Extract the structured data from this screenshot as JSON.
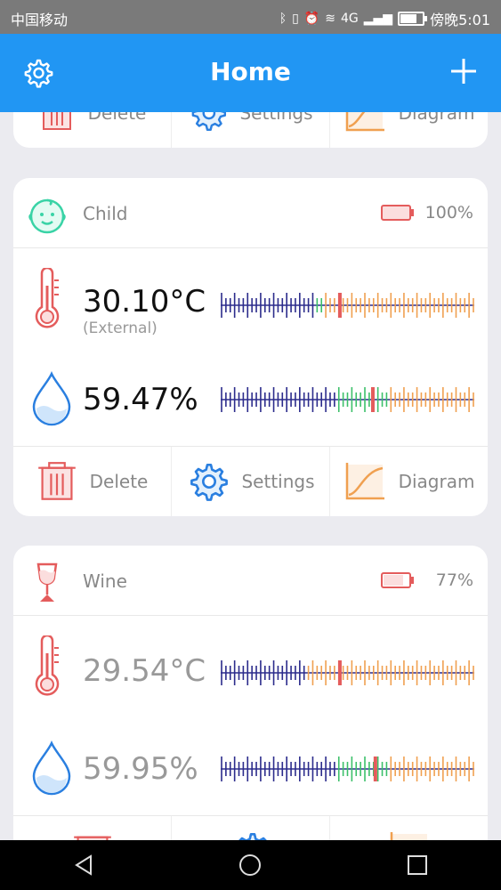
{
  "status_bar": {
    "carrier": "中国移动",
    "time": "傍晚5:01",
    "signal_label": "4G"
  },
  "app_bar": {
    "title": "Home",
    "settings_icon": "gear-icon",
    "add_icon": "plus-icon"
  },
  "actions": {
    "delete": "Delete",
    "settings": "Settings",
    "diagram": "Diagram"
  },
  "colors": {
    "accent": "#2196f3",
    "red": "#e45c5c",
    "blue": "#2a7fe0",
    "orange": "#f0a050",
    "green": "#3cc06a",
    "teal": "#39d3a6"
  },
  "devices": [
    {
      "name": "Child",
      "battery": "100%",
      "battery_level": 1.0,
      "temperature": "30.10°C",
      "temperature_note": "(External)",
      "temperature_marker": 0.47,
      "humidity": "59.47%",
      "humidity_marker": 0.6
    },
    {
      "name": "Wine",
      "battery": "77%",
      "battery_level": 0.77,
      "temperature": "29.54°C",
      "temperature_marker": 0.47,
      "humidity": "59.95%",
      "humidity_marker": 0.61
    }
  ]
}
